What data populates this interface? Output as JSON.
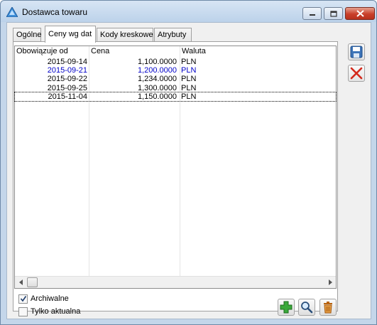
{
  "window": {
    "title": "Dostawca towaru",
    "controls": {
      "minimize": "minimize",
      "maximize": "maximize",
      "close": "close"
    }
  },
  "tabs": [
    {
      "label": "Ogólne",
      "active": false
    },
    {
      "label": "Ceny wg dat",
      "active": true
    },
    {
      "label": "Kody kreskowe",
      "active": false
    },
    {
      "label": "Atrybuty",
      "active": false
    }
  ],
  "grid": {
    "columns": [
      "Obowiązuje od",
      "Cena",
      "Waluta"
    ],
    "rows": [
      {
        "date": "2015-09-14",
        "price": "1,100.0000",
        "currency": "PLN",
        "highlight": false,
        "selected": false
      },
      {
        "date": "2015-09-21",
        "price": "1,200.0000",
        "currency": "PLN",
        "highlight": true,
        "selected": false
      },
      {
        "date": "2015-09-22",
        "price": "1,234.0000",
        "currency": "PLN",
        "highlight": false,
        "selected": false
      },
      {
        "date": "2015-09-25",
        "price": "1,300.0000",
        "currency": "PLN",
        "highlight": false,
        "selected": false
      },
      {
        "date": "2015-11-04",
        "price": "1,150.0000",
        "currency": "PLN",
        "highlight": false,
        "selected": true
      }
    ],
    "highlight_color": "#0000c8"
  },
  "options": {
    "archiwalne": {
      "label": "Archiwalne",
      "checked": true
    },
    "tylko_aktualna": {
      "label": "Tylko aktualna",
      "checked": false
    }
  },
  "toolbar": {
    "add_icon": "plus-icon",
    "preview_icon": "magnifier-icon",
    "delete_icon": "trash-icon"
  },
  "side": {
    "save_icon": "floppy-disk-icon",
    "cancel_icon": "red-x-icon"
  }
}
